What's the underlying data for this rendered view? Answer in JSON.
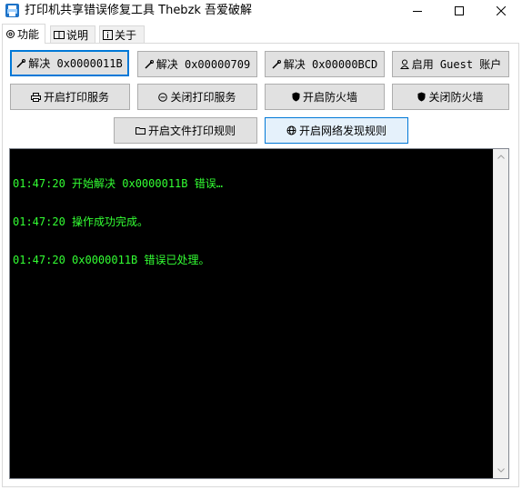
{
  "window": {
    "title": "打印机共享错误修复工具   Thebzk 吾爱破解",
    "icon": "printer-app-icon",
    "controls": {
      "minimize": "minimize-icon",
      "maximize": "maximize-icon",
      "close": "close-icon"
    }
  },
  "tabs": [
    {
      "label": "功能",
      "icon": "gear-icon",
      "active": true
    },
    {
      "label": "说明",
      "icon": "book-icon",
      "active": false
    },
    {
      "label": "关于",
      "icon": "info-icon",
      "active": false
    }
  ],
  "buttons": {
    "fix_11b": {
      "label": "解决 0x0000011B",
      "icon": "wrench-icon"
    },
    "fix_709": {
      "label": "解决 0x00000709",
      "icon": "wrench-icon"
    },
    "fix_bcd": {
      "label": "解决 0x00000BCD",
      "icon": "wrench-icon"
    },
    "enable_guest": {
      "label": "启用 Guest 账户",
      "icon": "user-icon"
    },
    "start_spooler": {
      "label": "开启打印服务",
      "icon": "printer-icon"
    },
    "stop_spooler": {
      "label": "关闭打印服务",
      "icon": "stop-icon"
    },
    "enable_firewall": {
      "label": "开启防火墙",
      "icon": "shield-icon"
    },
    "disable_firewall": {
      "label": "关闭防火墙",
      "icon": "shield-icon"
    },
    "file_print_rule": {
      "label": "开启文件打印规则",
      "icon": "folder-icon"
    },
    "network_discovery_rule": {
      "label": "开启网络发现规则",
      "icon": "globe-icon"
    }
  },
  "log": {
    "lines": [
      "01:47:20 开始解决 0x0000011B 错误…",
      "01:47:20 操作成功完成。",
      "01:47:20 0x0000011B 错误已处理。"
    ]
  },
  "colors": {
    "console_bg": "#000000",
    "console_text": "#33ff33",
    "button_bg": "#e1e1e1",
    "focus_accent": "#0078d7"
  }
}
